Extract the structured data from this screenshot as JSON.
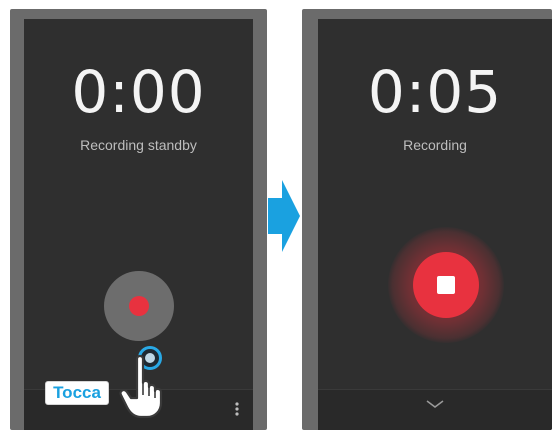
{
  "left_screen": {
    "timer": "0:00",
    "status": "Recording standby",
    "tap_label": "Tocca",
    "record_icon": "record-icon",
    "chevron_icon": "chevron-down-icon",
    "overflow_icon": "overflow-menu-icon"
  },
  "right_screen": {
    "timer": "0:05",
    "status": "Recording",
    "stop_icon": "stop-icon",
    "chevron_icon": "chevron-down-icon"
  },
  "colors": {
    "record_red": "#e8323f",
    "screen_bg": "#2f2f2f",
    "frame_bg": "#6b6b6b",
    "arrow_blue": "#1aa1e0",
    "tap_text": "#1aa1e0"
  }
}
